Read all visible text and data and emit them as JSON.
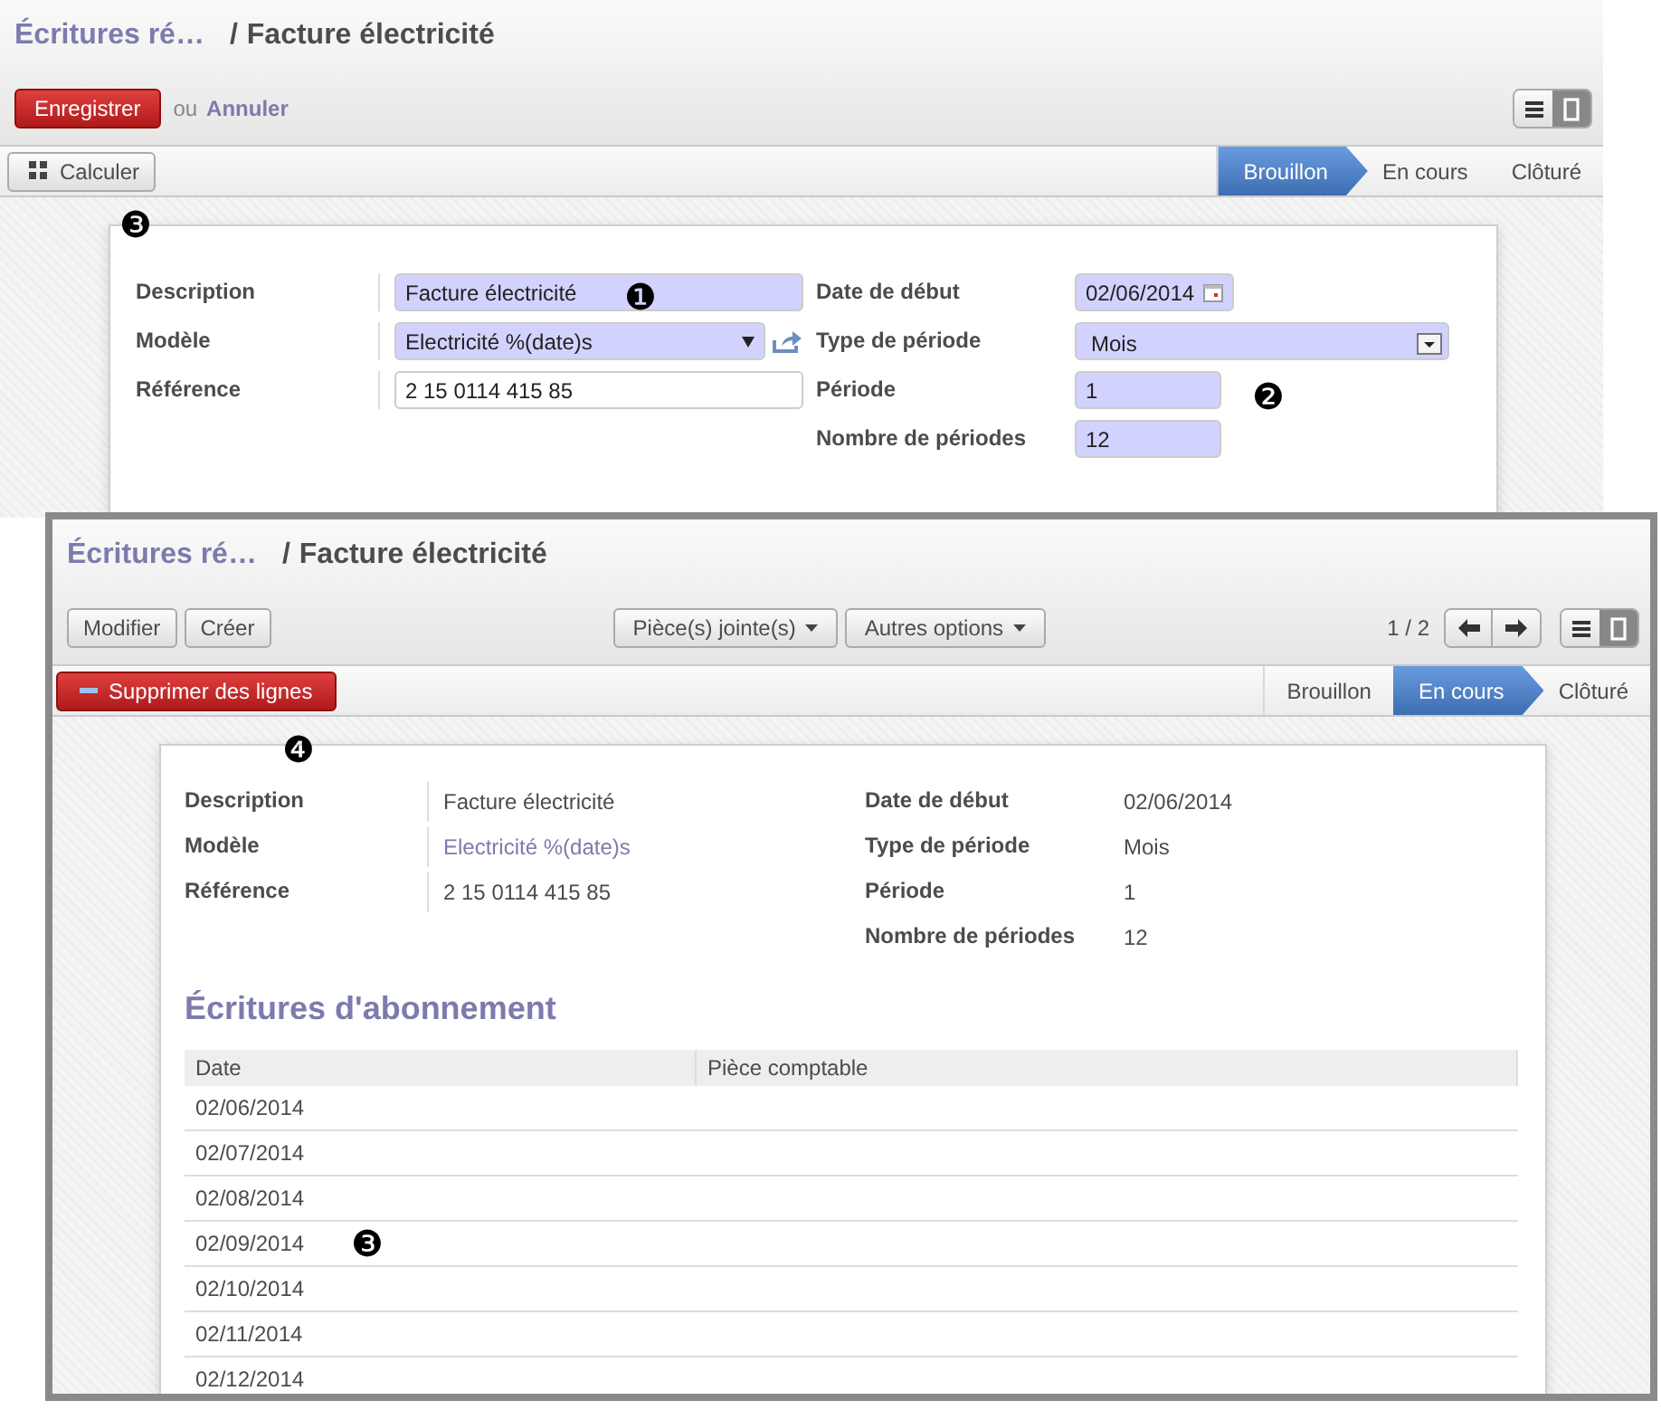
{
  "edit_screen": {
    "breadcrumb": {
      "parent": "Écritures ré…",
      "separator": "/",
      "current": "Facture électricité"
    },
    "save_button": "Enregistrer",
    "or_text": "ou",
    "cancel_link": "Annuler",
    "views": [
      {
        "kind": "list",
        "selected": false
      },
      {
        "kind": "form",
        "selected": true
      }
    ],
    "action_button": {
      "label": "Calculer",
      "callout": "❸"
    },
    "statusbar": [
      {
        "label": "Brouillon",
        "selected": true
      },
      {
        "label": "En cours",
        "selected": false
      },
      {
        "label": "Clôturé",
        "selected": false
      }
    ],
    "left_fields": [
      {
        "label": "Description",
        "kind": "text",
        "required": true,
        "value": "Facture électricité",
        "callout": "❶"
      },
      {
        "label": "Modèle",
        "kind": "many2one",
        "required": true,
        "value": "Electricité %(date)s"
      },
      {
        "label": "Référence",
        "kind": "text",
        "required": false,
        "value": "2 15 0114 415 85"
      }
    ],
    "right_fields": [
      {
        "label": "Date de début",
        "kind": "date",
        "required": true,
        "value": "02/06/2014"
      },
      {
        "label": "Type de période",
        "kind": "selection",
        "required": true,
        "value": "Mois"
      },
      {
        "label": "Période",
        "kind": "short",
        "required": true,
        "value": "1",
        "callout": "❷"
      },
      {
        "label": "Nombre de périodes",
        "kind": "short",
        "required": true,
        "value": "12"
      }
    ]
  },
  "view_screen": {
    "breadcrumb": {
      "parent": "Écritures ré…",
      "separator": "/",
      "current": "Facture électricité"
    },
    "buttons": [
      "Modifier",
      "Créer"
    ],
    "dropdowns": [
      "Pièce(s) jointe(s)",
      "Autres options"
    ],
    "pager": "1 / 2",
    "views": [
      {
        "kind": "list",
        "selected": false
      },
      {
        "kind": "form",
        "selected": true
      }
    ],
    "action_button": {
      "label": "Supprimer des lignes",
      "callout": "❹"
    },
    "statusbar": [
      {
        "label": "Brouillon",
        "selected": false
      },
      {
        "label": "En cours",
        "selected": true
      },
      {
        "label": "Clôturé",
        "selected": false
      }
    ],
    "left_fields": [
      {
        "label": "Description",
        "kind": "text",
        "value": "Facture électricité"
      },
      {
        "label": "Modèle",
        "kind": "link",
        "value": "Electricité %(date)s"
      },
      {
        "label": "Référence",
        "kind": "text",
        "value": "2 15 0114 415 85"
      }
    ],
    "right_fields": [
      {
        "label": "Date de début",
        "kind": "text",
        "value": "02/06/2014"
      },
      {
        "label": "Type de période",
        "kind": "text",
        "value": "Mois"
      },
      {
        "label": "Période",
        "kind": "text",
        "value": "1"
      },
      {
        "label": "Nombre de périodes",
        "kind": "text",
        "value": "12"
      }
    ],
    "section_title": "Écritures d'abonnement",
    "table": {
      "columns": [
        "Date",
        "Pièce comptable"
      ],
      "rows": [
        {
          "cells": [
            "02/06/2014"
          ]
        },
        {
          "cells": [
            "02/07/2014"
          ]
        },
        {
          "cells": [
            "02/08/2014"
          ]
        },
        {
          "cells": [
            "02/09/2014"
          ],
          "callout": "❸"
        },
        {
          "cells": [
            "02/10/2014"
          ]
        },
        {
          "cells": [
            "02/11/2014"
          ]
        },
        {
          "cells": [
            "02/12/2014"
          ]
        }
      ]
    }
  }
}
